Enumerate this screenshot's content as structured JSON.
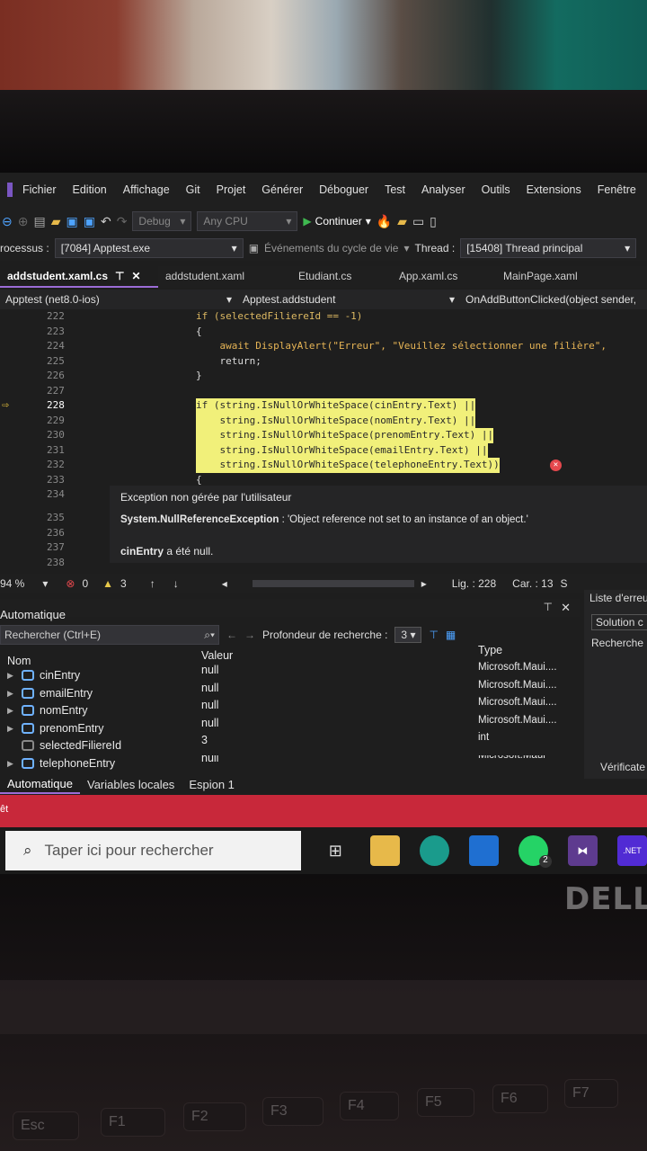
{
  "menu": [
    "Fichier",
    "Edition",
    "Affichage",
    "Git",
    "Projet",
    "Générer",
    "Déboguer",
    "Test",
    "Analyser",
    "Outils",
    "Extensions",
    "Fenêtre"
  ],
  "toolbar": {
    "config": "Debug",
    "platform": "Any CPU",
    "continue": "Continuer"
  },
  "procbar": {
    "label": "rocessus :",
    "process": "[7084] Apptest.exe",
    "lifecycle": "Événements du cycle de vie",
    "thread_label": "Thread :",
    "thread": "[15408] Thread principal"
  },
  "tabs": [
    "addstudent.xaml.cs",
    "addstudent.xaml",
    "Etudiant.cs",
    "App.xaml.cs",
    "MainPage.xaml"
  ],
  "navbar": {
    "project": "Apptest (net8.0-ios)",
    "class": "Apptest.addstudent",
    "method": "OnAddButtonClicked(object sender,"
  },
  "code": {
    "lines": [
      "222",
      "223",
      "224",
      "225",
      "226",
      "227",
      "228",
      "229",
      "230",
      "231",
      "232",
      "233",
      "234",
      "235",
      "236",
      "237",
      "238"
    ],
    "l222": "if (selectedFiliereId == -1)",
    "l223": "{",
    "l224": "    await DisplayAlert(\"Erreur\", \"Veuillez sélectionner une filière\",",
    "l225": "    return;",
    "l226": "}",
    "l228": "if (string.IsNullOrWhiteSpace(cinEntry.Text) ||",
    "l229": "    string.IsNullOrWhiteSpace(nomEntry.Text) ||",
    "l230": "    string.IsNullOrWhiteSpace(prenomEntry.Text) ||",
    "l231": "    string.IsNullOrWhiteSpace(emailEntry.Text) ||",
    "l232": "    string.IsNullOrWhiteSpace(telephoneEntry.Text))",
    "l233": "{"
  },
  "exception": {
    "title": "Exception non gérée par l'utilisateur",
    "type": "System.NullReferenceException",
    "message": " : 'Object reference not set to an instance of an object.'",
    "var": "cinEntry",
    "detail": " a été null."
  },
  "status": {
    "zoom": "94 %",
    "errors": "0",
    "warnings": "3",
    "line": "Lig. : 228",
    "col": "Car. : 13",
    "extra": "S"
  },
  "auto": {
    "title": "Automatique",
    "search": "Rechercher (Ctrl+E)",
    "depth_label": "Profondeur de recherche :",
    "depth": "3",
    "col_name": "Nom",
    "col_value": "Valeur",
    "col_type": "Type",
    "rows": [
      {
        "name": "cinEntry",
        "value": "null",
        "type": "Microsoft.Maui...."
      },
      {
        "name": "emailEntry",
        "value": "null",
        "type": "Microsoft.Maui...."
      },
      {
        "name": "nomEntry",
        "value": "null",
        "type": "Microsoft.Maui...."
      },
      {
        "name": "prenomEntry",
        "value": "null",
        "type": "Microsoft.Maui...."
      },
      {
        "name": "selectedFiliereId",
        "value": "3",
        "type": "int"
      },
      {
        "name": "telephoneEntry",
        "value": "null",
        "type": "Microsoft.Maui"
      }
    ]
  },
  "bottom_tabs": [
    "Automatique",
    "Variables locales",
    "Espion 1"
  ],
  "right_panel": {
    "title": "Liste d'erreu",
    "solution": "Solution c",
    "search": "Recherche",
    "verify": "Vérificate"
  },
  "taskbar": {
    "search_placeholder": "Taper ici pour rechercher",
    "whatsapp_badge": "2",
    "net": ".NET"
  },
  "brand": "DELL",
  "keys": [
    "Esc",
    "F1",
    "F2",
    "F3",
    "F4",
    "F5",
    "F6",
    "F7"
  ],
  "red_bar_text": "êt"
}
